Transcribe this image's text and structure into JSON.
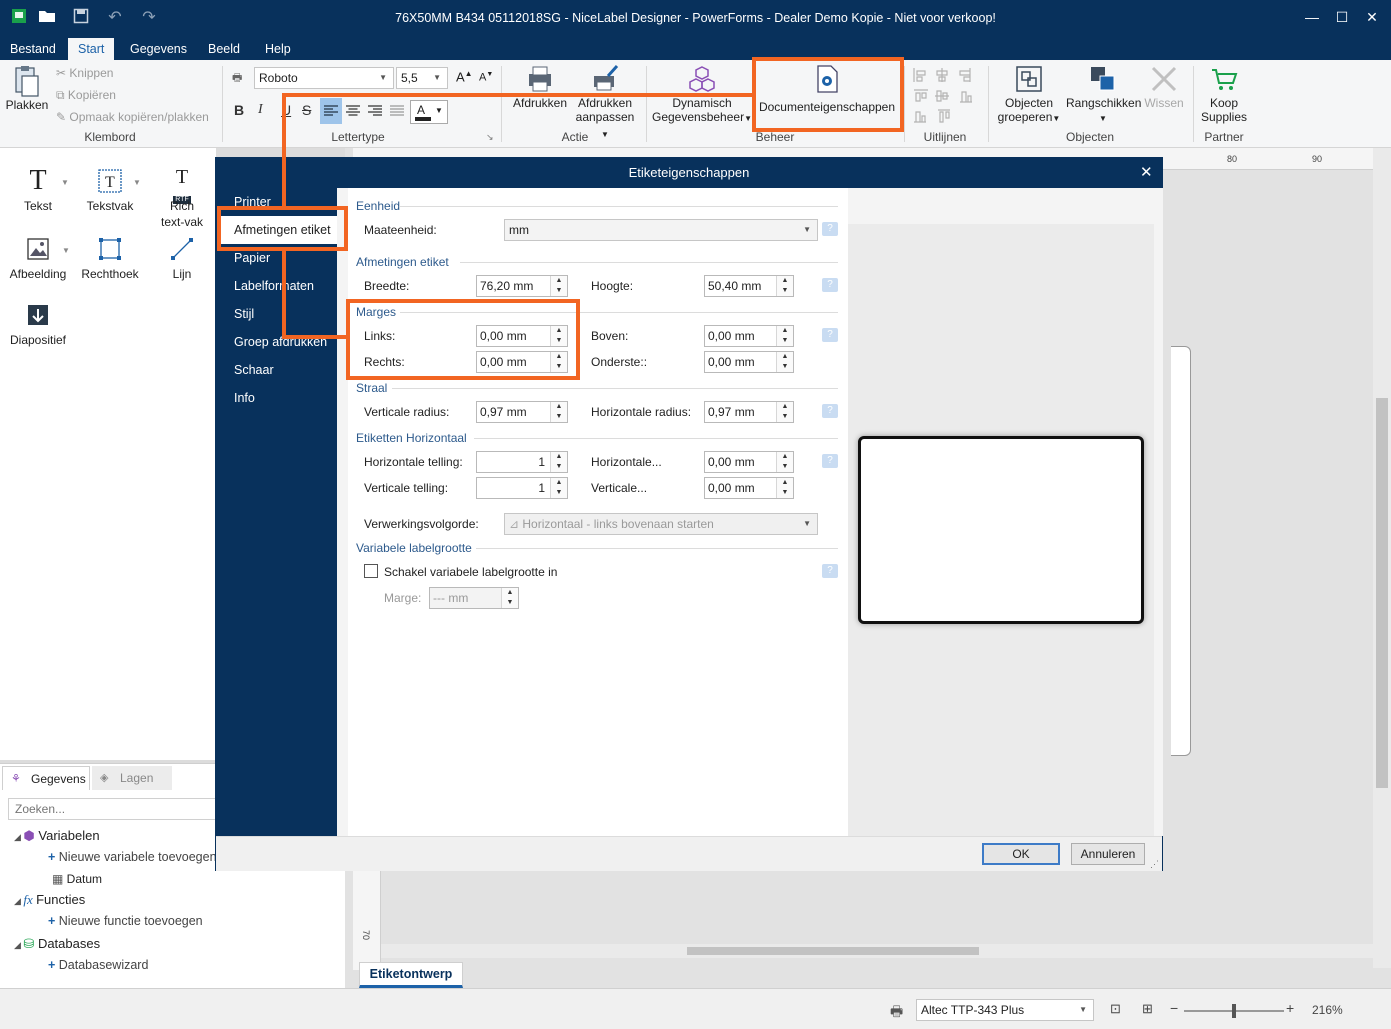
{
  "window": {
    "title": "76X50MM B434 05112018SG - NiceLabel Designer - PowerForms - Dealer Demo Kopie - Niet voor verkoop!",
    "minimize_glyph": "—",
    "maximize_glyph": "☐",
    "close_glyph": "✕"
  },
  "menu": {
    "tabs": [
      "Bestand",
      "Start",
      "Gegevens",
      "Beeld",
      "Help"
    ],
    "active": "Start"
  },
  "ribbon": {
    "clipboard": {
      "paste": "Plakken",
      "cut": "Knippen",
      "copy": "Kopiëren",
      "format_painter": "Opmaak kopiëren/plakken",
      "group": "Klembord"
    },
    "font": {
      "family": "Roboto",
      "size": "5,5",
      "group": "Lettertype",
      "bold": "B",
      "italic": "I",
      "underline": "U",
      "strike": "S",
      "color_letter": "A"
    },
    "action": {
      "print": "Afdrukken",
      "print_custom_l1": "Afdrukken",
      "print_custom_l2": "aanpassen",
      "group": "Actie"
    },
    "manage": {
      "dynamic_l1": "Dynamisch",
      "dynamic_l2": "Gegevensbeheer",
      "docprops": "Documenteigenschappen",
      "group": "Beheer"
    },
    "align": {
      "group": "Uitlijnen"
    },
    "objects": {
      "group_l1": "Objecten",
      "group_l2": "groeperen",
      "arrange": "Rangschikken",
      "delete": "Wissen",
      "group": "Objecten"
    },
    "partner": {
      "buy_l1": "Koop",
      "buy_l2": "Supplies",
      "group": "Partner"
    }
  },
  "toolbox": {
    "text": "Tekst",
    "textbox": "Tekstvak",
    "richtext_l1": "Rich",
    "richtext_l2": "text-vak",
    "richtext_badge": "RTF",
    "image": "Afbeelding",
    "rectangle": "Rechthoek",
    "line": "Lijn",
    "inverse": "Diapositief"
  },
  "datapanel": {
    "tab_data": "Gegevens",
    "tab_layers": "Lagen",
    "search_placeholder": "Zoeken...",
    "variables": "Variabelen",
    "new_variable": "Nieuwe variabele toevoegen",
    "date": "Datum",
    "functions": "Functies",
    "new_function": "Nieuwe functie toevoegen",
    "databases": "Databases",
    "db_wizard": "Databasewizard"
  },
  "canvas": {
    "ruler_80": "80",
    "ruler_90": "90",
    "ruler_70": "70",
    "design_tab": "Etiketontwerp"
  },
  "statusbar": {
    "printer": "Altec TTP-343 Plus",
    "zoom": "216%"
  },
  "dialog": {
    "title": "Etiketeigenschappen",
    "nav": [
      "Printer",
      "Afmetingen etiket",
      "Papier",
      "Labelformaten",
      "Stijl",
      "Groep afdrukken",
      "Schaar",
      "Info"
    ],
    "selected_nav": "Afmetingen etiket",
    "unit": {
      "heading": "Eenheid",
      "label": "Maateenheid:",
      "value": "mm"
    },
    "dimensions": {
      "heading": "Afmetingen etiket",
      "width_label": "Breedte:",
      "width_value": "76,20 mm",
      "height_label": "Hoogte:",
      "height_value": "50,40 mm"
    },
    "margins": {
      "heading": "Marges",
      "left_label": "Links:",
      "left_value": "0,00 mm",
      "right_label": "Rechts:",
      "right_value": "0,00 mm",
      "top_label": "Boven:",
      "top_value": "0,00 mm",
      "bottom_label": "Onderste::",
      "bottom_value": "0,00 mm"
    },
    "radius": {
      "heading": "Straal",
      "vertical_label": "Verticale radius:",
      "vertical_value": "0,97 mm",
      "horizontal_label": "Horizontale radius:",
      "horizontal_value": "0,97 mm"
    },
    "labels_across": {
      "heading": "Etiketten Horizontaal",
      "h_count_label": "Horizontale telling:",
      "h_count_value": "1",
      "v_count_label": "Verticale telling:",
      "v_count_value": "1",
      "h_gap_label": "Horizontale...",
      "h_gap_value": "0,00 mm",
      "v_gap_label": "Verticale...",
      "v_gap_value": "0,00 mm",
      "order_label": "Verwerkingsvolgorde:",
      "order_value": "Horizontaal - links bovenaan starten"
    },
    "variable_size": {
      "heading": "Variabele labelgrootte",
      "checkbox_label": "Schakel variabele labelgrootte in",
      "margin_label": "Marge:",
      "margin_placeholder": "--- mm"
    },
    "ok": "OK",
    "cancel": "Annuleren",
    "help_glyph": "?",
    "close_glyph": "✕"
  },
  "colors": {
    "title_bar": "#08315c",
    "highlight": "#f26522",
    "accent": "#1d62a8"
  }
}
